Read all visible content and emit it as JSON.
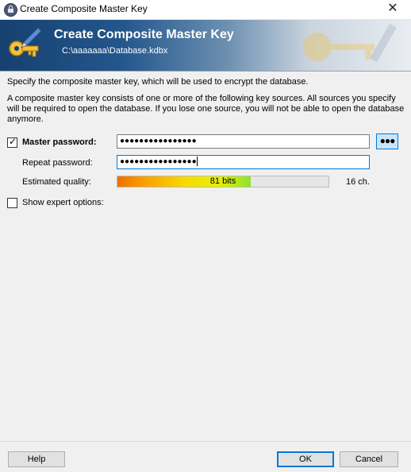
{
  "window": {
    "title": "Create Composite Master Key",
    "close_glyph": "✕"
  },
  "banner": {
    "heading": "Create Composite Master Key",
    "path": "C:\\aaaaaaa\\Database.kdbx"
  },
  "description": "Specify the composite master key, which will be used to encrypt the database.",
  "info": "A composite master key consists of one or more of the following key sources. All sources you specify will be required to open the database. If you lose one source, you will not be able to open the database anymore.",
  "master_password": {
    "checkbox_checked": true,
    "label": "Master password:",
    "value": "●●●●●●●●●●●●●●●●",
    "toggle_label": "●●●"
  },
  "repeat_password": {
    "label": "Repeat password:",
    "value": "●●●●●●●●●●●●●●●●"
  },
  "quality": {
    "label": "Estimated quality:",
    "bits_text": "81 bits",
    "fraction": 0.63,
    "chars_text": "16 ch."
  },
  "expert": {
    "checkbox_checked": false,
    "label": "Show expert options:"
  },
  "buttons": {
    "help": "Help",
    "ok": "OK",
    "cancel": "Cancel"
  },
  "colors": {
    "banner_dark": "#16406f",
    "focus_accent": "#0078d7"
  },
  "icons": {
    "app": "lock-icon",
    "banner": "key-pen-icon"
  }
}
